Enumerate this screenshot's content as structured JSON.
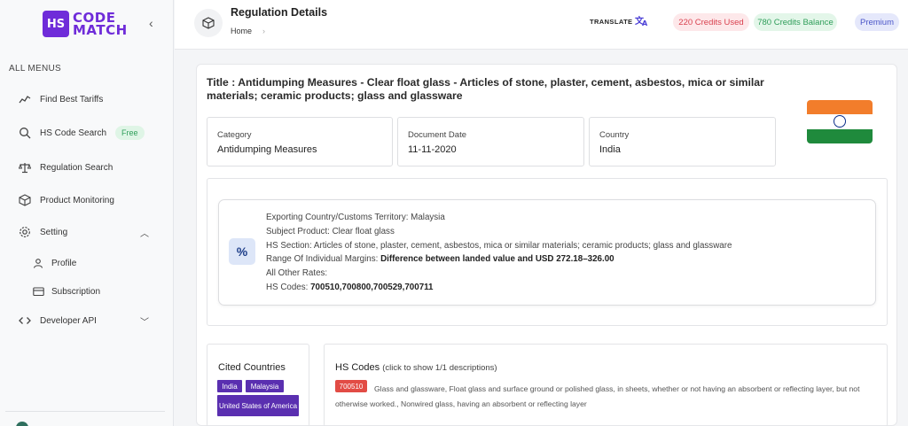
{
  "brand": {
    "logo_mark": "HS",
    "line1": "CODE",
    "line2": "MATCH",
    "color": "#6f2cd9"
  },
  "sidebar": {
    "heading": "ALL MENUS",
    "items": [
      {
        "label": "Find Best Tariffs",
        "icon": "trend-icon"
      },
      {
        "label": "HS Code Search",
        "icon": "search-icon",
        "badge": "Free"
      },
      {
        "label": "Regulation Search",
        "icon": "scale-icon"
      },
      {
        "label": "Product Monitoring",
        "icon": "box-icon"
      },
      {
        "label": "Setting",
        "icon": "gear-icon"
      },
      {
        "label": "Profile",
        "icon": "user-icon"
      },
      {
        "label": "Subscription",
        "icon": "card-icon"
      },
      {
        "label": "Developer API",
        "icon": "code-icon"
      }
    ]
  },
  "header": {
    "title": "Regulation Details",
    "breadcrumb": "Home",
    "translate_label": "TRANSLATE",
    "credits_used": "220 Credits Used",
    "credits_balance": "780 Credits Balance",
    "plan": "Premium"
  },
  "regulation": {
    "title": "Title : Antidumping Measures - Clear float glass - Articles of stone, plaster, cement, asbestos, mica or similar materials; ceramic products; glass and glassware",
    "category_label": "Category",
    "category": "Antidumping Measures",
    "date_label": "Document Date",
    "date": "11-11-2020",
    "country_label": "Country",
    "country": "India",
    "details": {
      "exporting": "Exporting Country/Customs Territory: Malaysia",
      "subject": "Subject Product: Clear float glass",
      "section": "HS Section: Articles of stone, plaster, cement, asbestos, mica or similar materials; ceramic products; glass and glassware",
      "margins_label": "Range Of Individual Margins: ",
      "margins_value": "Difference between landed value and USD 272.18–326.00",
      "other_rates": "All Other Rates:",
      "hs_codes_label": "HS Codes: ",
      "hs_codes_value": "700510,700800,700529,700711"
    }
  },
  "cited": {
    "title": "Cited Countries",
    "countries": [
      "India",
      "Malaysia",
      "United States of America"
    ]
  },
  "hs_panel": {
    "title": "HS Codes",
    "note": "(click to show 1/1 descriptions)",
    "code": "700510",
    "description": "Glass and glassware, Float glass and surface ground or polished glass, in sheets, whether or not having an absorbent or reflecting layer, but not otherwise worked., Nonwired glass, having an absorbent or reflecting layer"
  },
  "flag_colors": [
    "#f27d2b",
    "#ffffff",
    "#1f8a3c"
  ]
}
